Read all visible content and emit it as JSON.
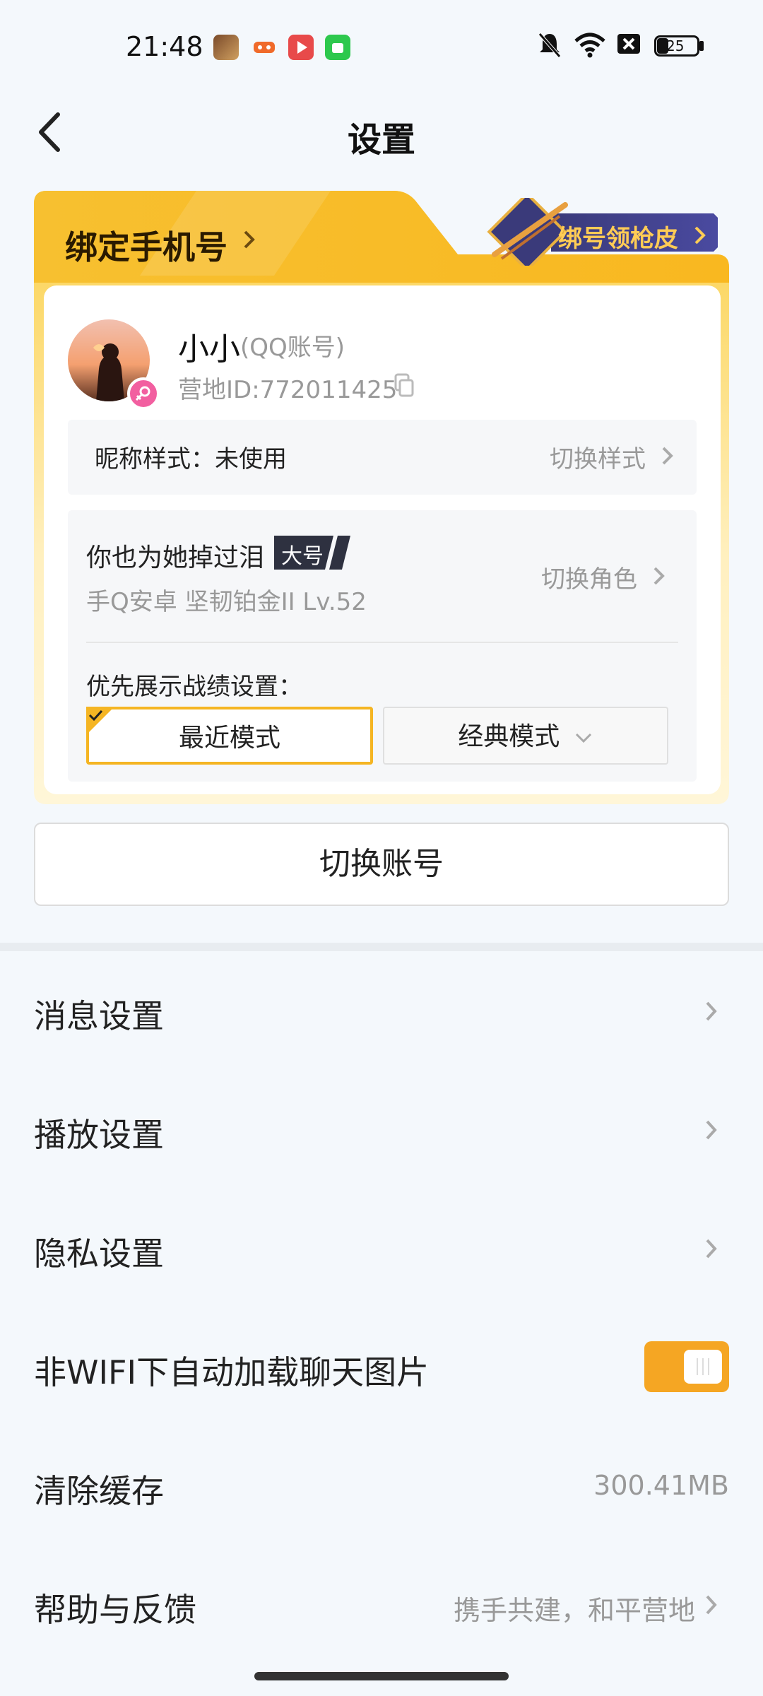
{
  "status_bar": {
    "time": "21:48",
    "battery": "25",
    "icons": [
      "game-app-icon",
      "controller-app-icon",
      "video-app-icon",
      "wechat-app-icon",
      "mute-icon",
      "wifi-icon",
      "sim-off-icon",
      "battery-icon"
    ]
  },
  "header": {
    "title": "设置"
  },
  "account_card": {
    "bind_phone": "绑定手机号",
    "promo": "绑号领枪皮",
    "username": "小小",
    "account_type": "(QQ账号)",
    "camp_id": "营地ID:772011425",
    "nickname_style_label": "昵称样式：未使用",
    "nickname_style_action": "切换样式",
    "role_name": "你也为她掉过泪",
    "role_badge": "大号",
    "role_meta": "手Q安卓  坚韧铂金II  Lv.52",
    "role_switch": "切换角色",
    "pref_label": "优先展示战绩设置：",
    "mode_recent": "最近模式",
    "mode_classic": "经典模式"
  },
  "switch_account": "切换账号",
  "settings": {
    "message": "消息设置",
    "playback": "播放设置",
    "privacy": "隐私设置",
    "auto_load": "非WIFI下自动加载聊天图片",
    "clear_cache": "清除缓存",
    "cache_size": "300.41MB",
    "help": "帮助与反馈",
    "help_value": "携手共建，和平营地"
  },
  "colors": {
    "accent": "#f5b523",
    "toggle_on": "#f5a623",
    "background": "#f4f8fc"
  }
}
